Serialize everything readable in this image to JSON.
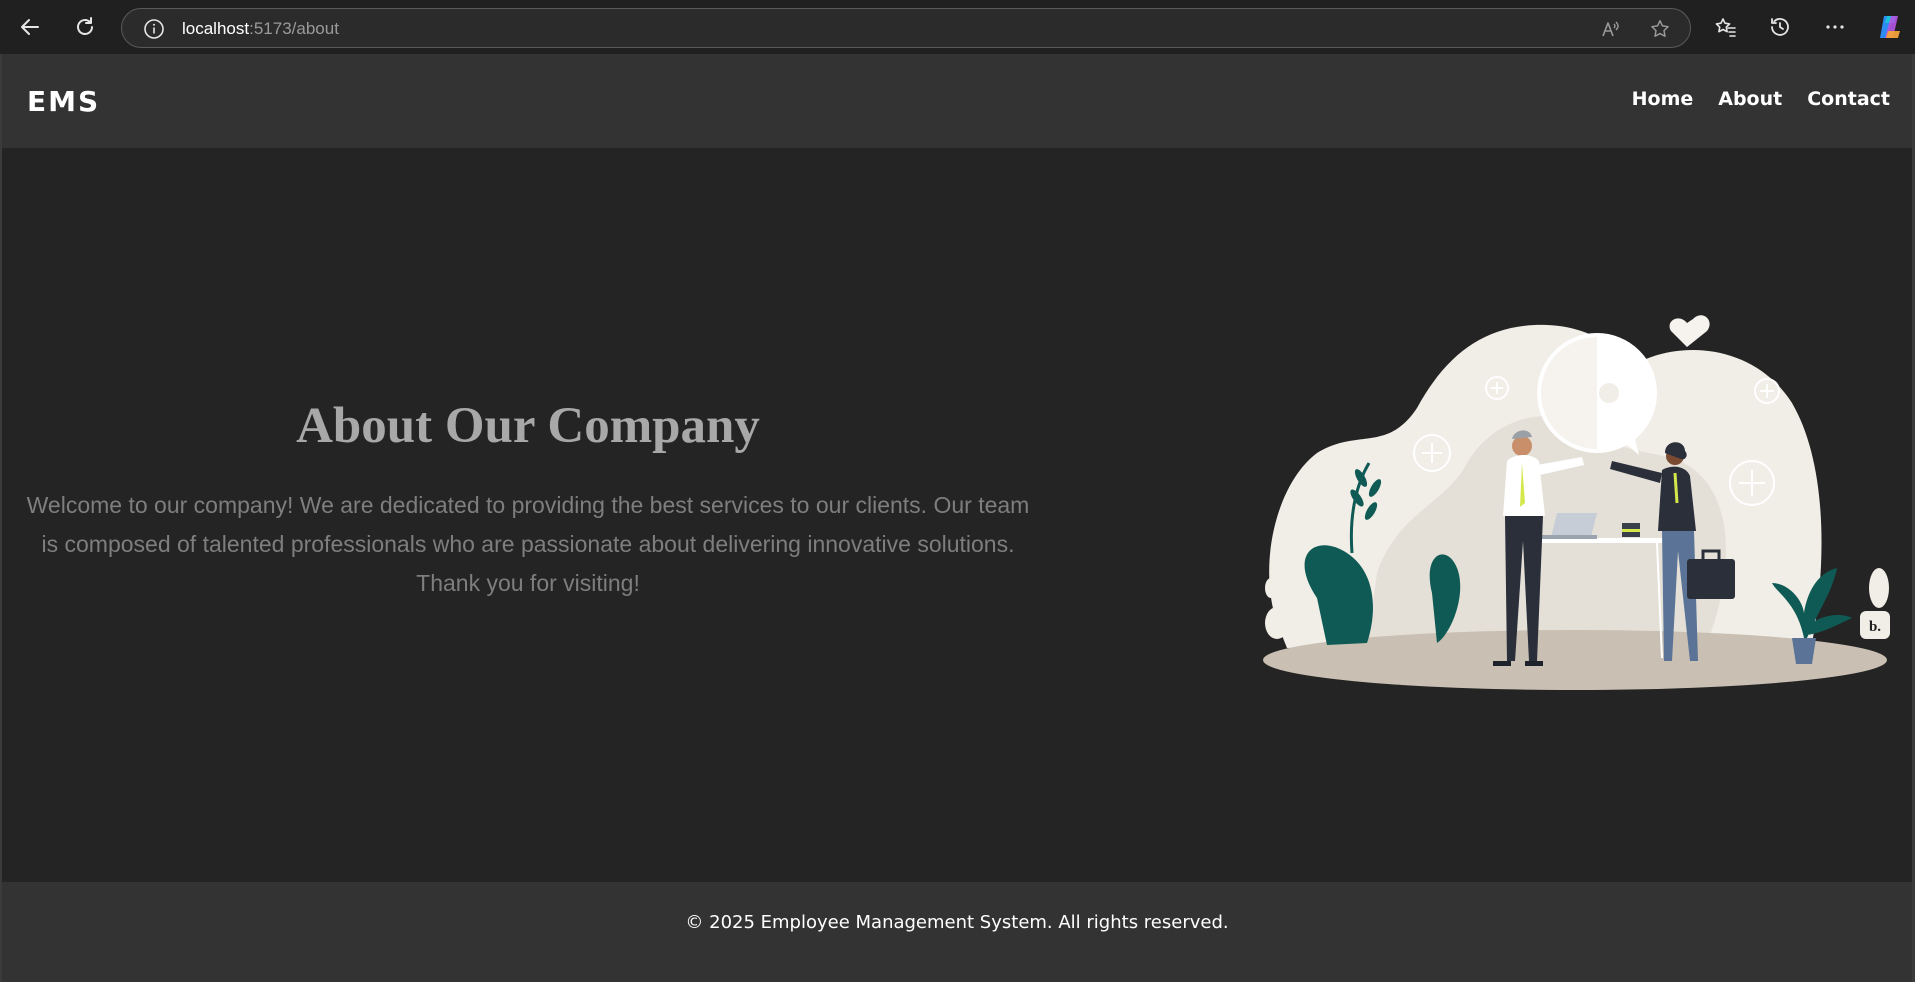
{
  "browser": {
    "url_host": "localhost",
    "url_path": ":5173/about",
    "icons": [
      "back-icon",
      "refresh-icon",
      "info-icon",
      "read-aloud-icon",
      "favorite-star-icon",
      "favorites-icon",
      "history-icon",
      "more-icon",
      "copilot-icon"
    ]
  },
  "navbar": {
    "logo": "EMS",
    "links": [
      "Home",
      "About",
      "Contact"
    ]
  },
  "hero": {
    "title": "About Our Company",
    "body": "Welcome to our company! We are dedicated to providing the best services to our clients. Our team is composed of talented professionals who are passionate about delivering innovative solutions. Thank you for visiting!",
    "badge": "b."
  },
  "footer": {
    "text": "© 2025 Employee Management System. All rights reserved."
  },
  "colors": {
    "background": "#242424",
    "navbar": "#333333",
    "title": "#a8a8a8",
    "body_text": "#7e7e7e",
    "blob": "#f1ede7",
    "plant": "#0f5a55",
    "accent": "#d4e84a"
  }
}
